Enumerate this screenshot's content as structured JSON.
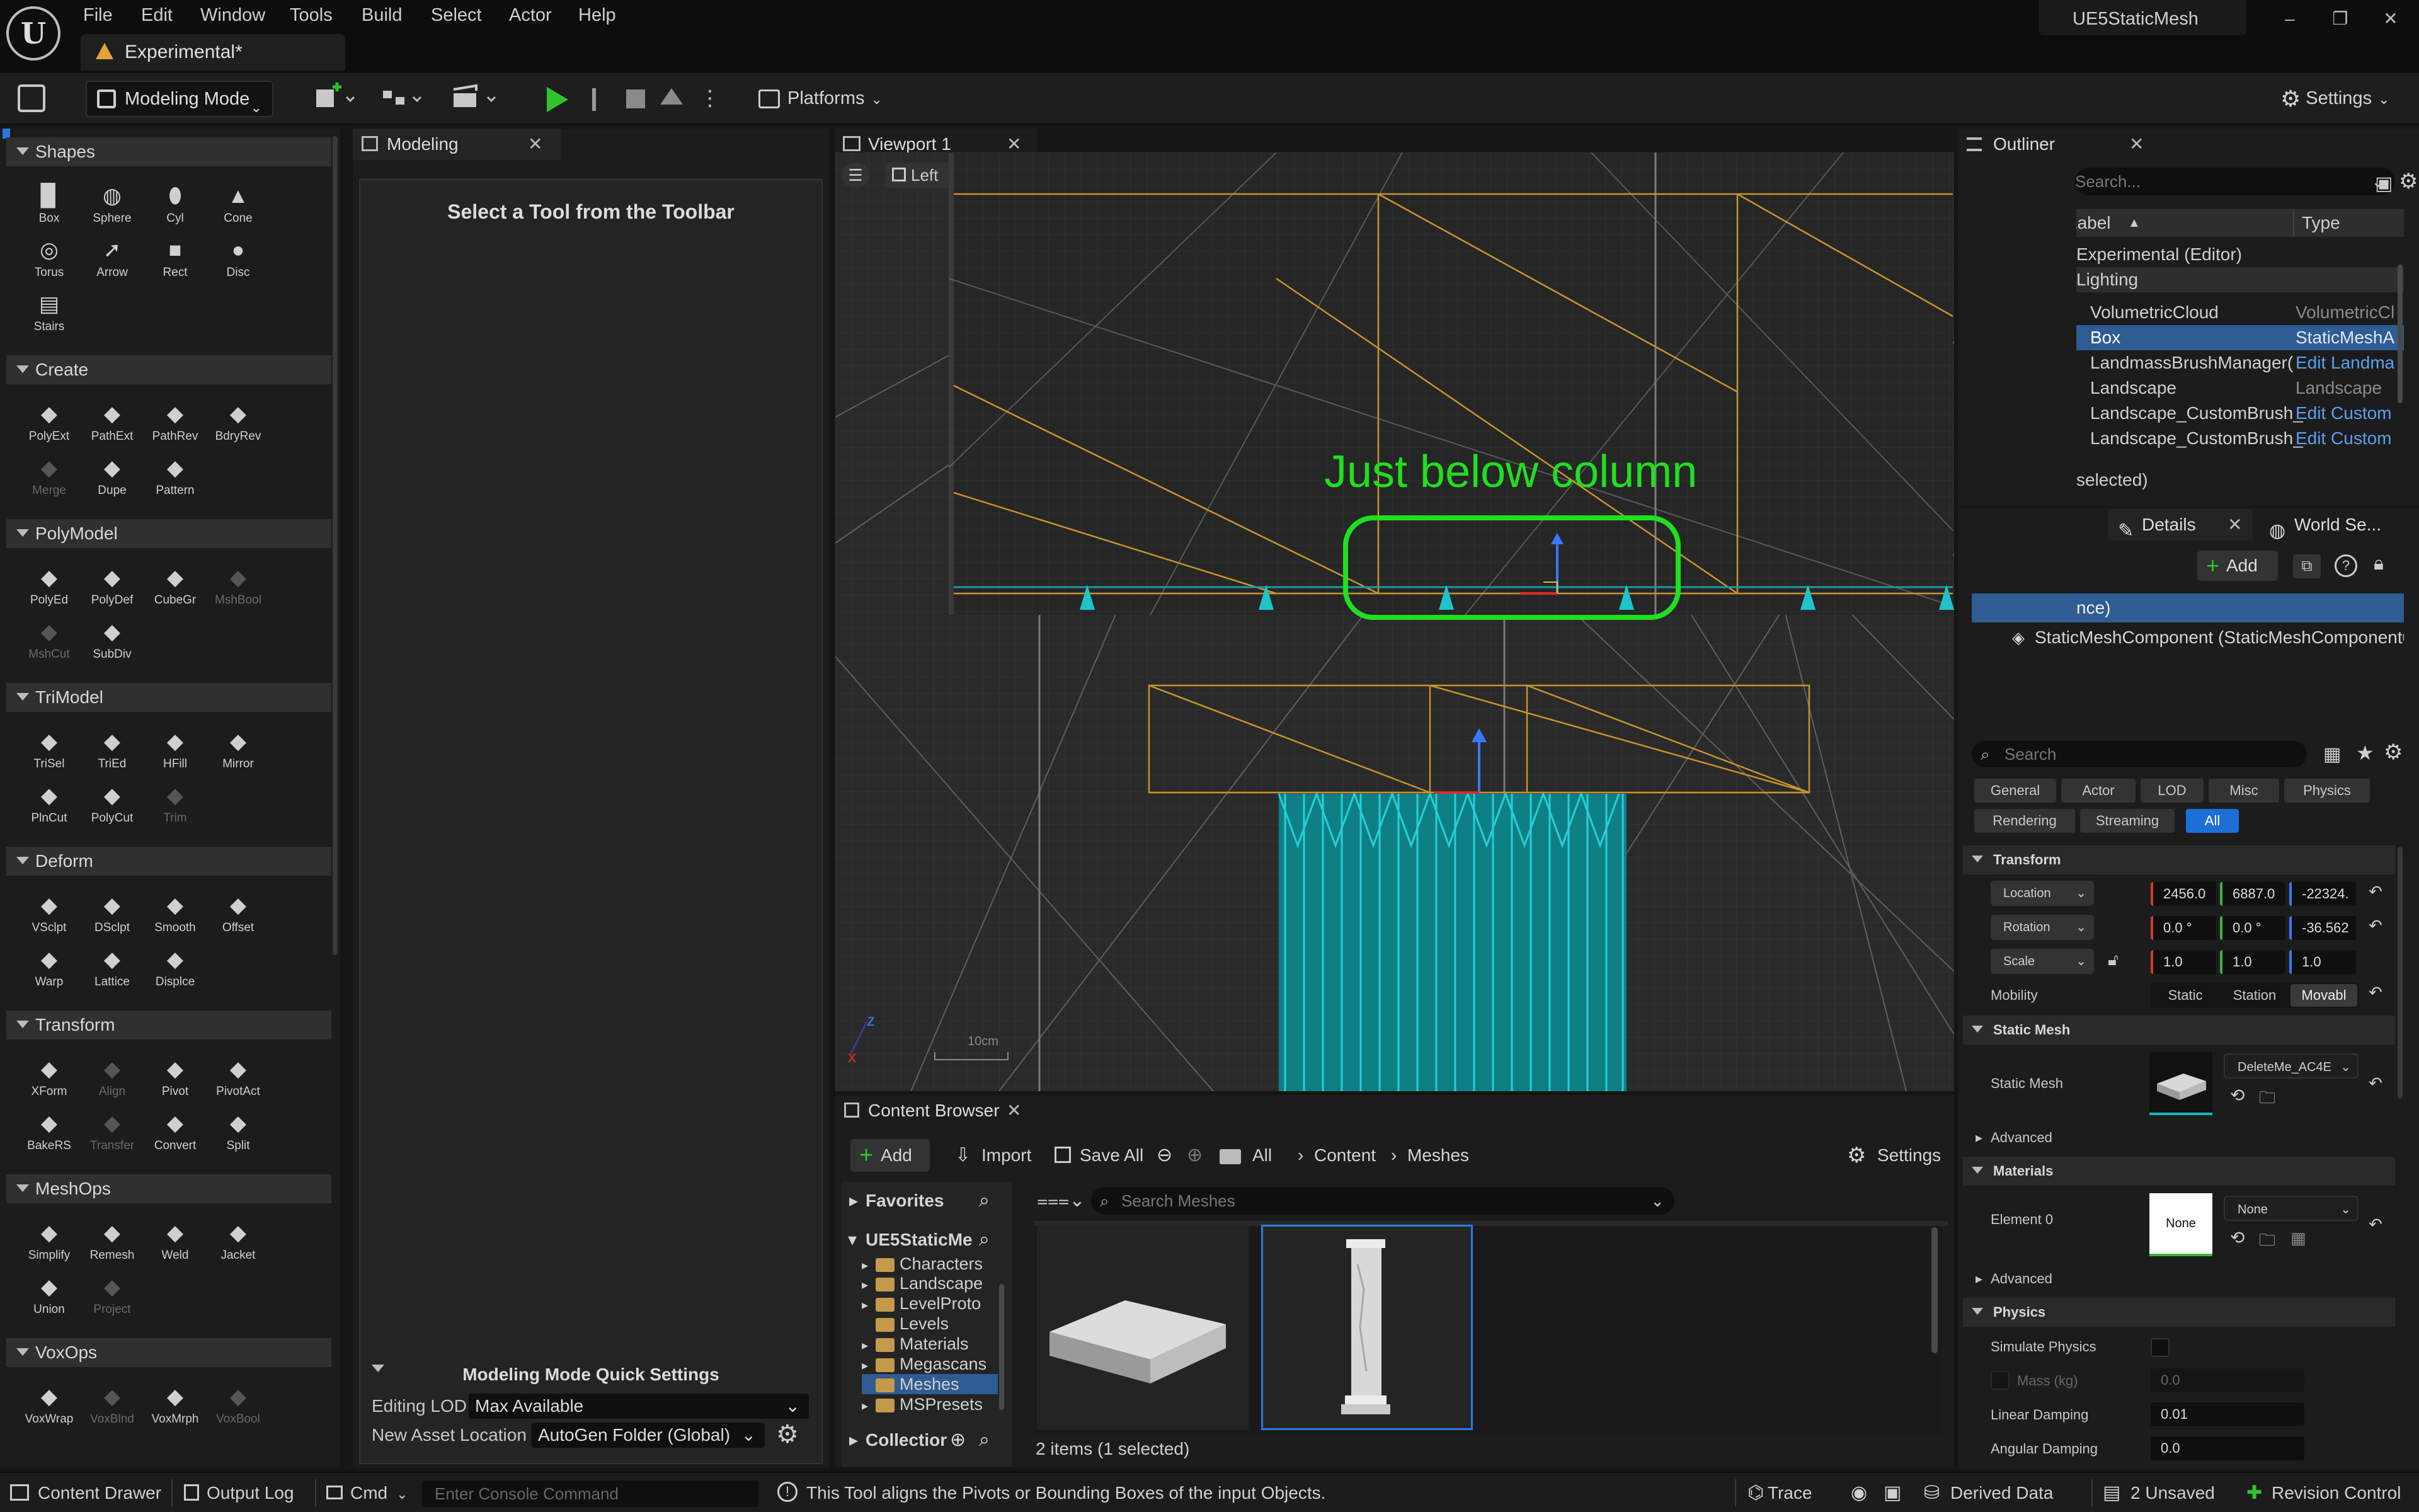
{
  "app": {
    "project": "UE5StaticMesh",
    "document_tab": "Experimental*",
    "menu": [
      "File",
      "Edit",
      "Window",
      "Tools",
      "Build",
      "Select",
      "Actor",
      "Help"
    ]
  },
  "toolbar": {
    "mode": "Modeling Mode",
    "platforms": "Platforms",
    "settings": "Settings"
  },
  "modeling_panel": {
    "tab": "Modeling",
    "prompt": "Select a Tool from the Toolbar",
    "quick_settings_title": "Modeling Mode Quick Settings",
    "editing_lod_label": "Editing LOD",
    "editing_lod_value": "Max Available",
    "asset_location_label": "New Asset Location",
    "asset_location_value": "AutoGen Folder (Global)"
  },
  "palette": {
    "sections": [
      {
        "title": "Shapes",
        "tools": [
          {
            "label": "Box",
            "icon": "box-icon"
          },
          {
            "label": "Sphere",
            "icon": "sphere-icon"
          },
          {
            "label": "Cyl",
            "icon": "cylinder-icon"
          },
          {
            "label": "Cone",
            "icon": "cone-icon"
          },
          {
            "label": "Torus",
            "icon": "torus-icon"
          },
          {
            "label": "Arrow",
            "icon": "arrow-icon"
          },
          {
            "label": "Rect",
            "icon": "rect-icon"
          },
          {
            "label": "Disc",
            "icon": "disc-icon"
          },
          {
            "label": "Stairs",
            "icon": "stairs-icon"
          }
        ]
      },
      {
        "title": "Create",
        "tools": [
          {
            "label": "PolyExt",
            "icon": "polyext-icon"
          },
          {
            "label": "PathExt",
            "icon": "pathext-icon"
          },
          {
            "label": "PathRev",
            "icon": "pathrev-icon"
          },
          {
            "label": "BdryRev",
            "icon": "bdryrev-icon"
          },
          {
            "label": "Merge",
            "icon": "merge-icon",
            "disabled": true
          },
          {
            "label": "Dupe",
            "icon": "dupe-icon"
          },
          {
            "label": "Pattern",
            "icon": "pattern-icon"
          }
        ]
      },
      {
        "title": "PolyModel",
        "tools": [
          {
            "label": "PolyEd",
            "icon": "polyed-icon"
          },
          {
            "label": "PolyDef",
            "icon": "polydef-icon"
          },
          {
            "label": "CubeGr",
            "icon": "cubegr-icon"
          },
          {
            "label": "MshBool",
            "icon": "mshbool-icon",
            "disabled": true
          },
          {
            "label": "MshCut",
            "icon": "mshcut-icon",
            "disabled": true
          },
          {
            "label": "SubDiv",
            "icon": "subdiv-icon"
          }
        ]
      },
      {
        "title": "TriModel",
        "tools": [
          {
            "label": "TriSel",
            "icon": "trisel-icon"
          },
          {
            "label": "TriEd",
            "icon": "tried-icon"
          },
          {
            "label": "HFill",
            "icon": "hfill-icon"
          },
          {
            "label": "Mirror",
            "icon": "mirror-icon"
          },
          {
            "label": "PlnCut",
            "icon": "plncut-icon"
          },
          {
            "label": "PolyCut",
            "icon": "polycut-icon"
          },
          {
            "label": "Trim",
            "icon": "trim-icon",
            "disabled": true
          }
        ]
      },
      {
        "title": "Deform",
        "tools": [
          {
            "label": "VSclpt",
            "icon": "vsclpt-icon"
          },
          {
            "label": "DSclpt",
            "icon": "dsclpt-icon"
          },
          {
            "label": "Smooth",
            "icon": "smooth-icon"
          },
          {
            "label": "Offset",
            "icon": "offset-icon"
          },
          {
            "label": "Warp",
            "icon": "warp-icon"
          },
          {
            "label": "Lattice",
            "icon": "lattice-icon"
          },
          {
            "label": "Displce",
            "icon": "displace-icon"
          }
        ]
      },
      {
        "title": "Transform",
        "tools": [
          {
            "label": "XForm",
            "icon": "xform-icon"
          },
          {
            "label": "Align",
            "icon": "align-icon",
            "disabled": true
          },
          {
            "label": "Pivot",
            "icon": "pivot-icon"
          },
          {
            "label": "PivotAct",
            "icon": "pivotact-icon"
          },
          {
            "label": "BakeRS",
            "icon": "bakers-icon"
          },
          {
            "label": "Transfer",
            "icon": "transfer-icon",
            "disabled": true
          },
          {
            "label": "Convert",
            "icon": "convert-icon"
          },
          {
            "label": "Split",
            "icon": "split-icon"
          }
        ]
      },
      {
        "title": "MeshOps",
        "tools": [
          {
            "label": "Simplify",
            "icon": "simplify-icon"
          },
          {
            "label": "Remesh",
            "icon": "remesh-icon"
          },
          {
            "label": "Weld",
            "icon": "weld-icon"
          },
          {
            "label": "Jacket",
            "icon": "jacket-icon"
          },
          {
            "label": "Union",
            "icon": "union-icon"
          },
          {
            "label": "Project",
            "icon": "project-icon",
            "disabled": true
          }
        ]
      },
      {
        "title": "VoxOps",
        "tools": [
          {
            "label": "VoxWrap",
            "icon": "voxwrap-icon"
          },
          {
            "label": "VoxBlnd",
            "icon": "voxblnd-icon",
            "disabled": true
          },
          {
            "label": "VoxMrph",
            "icon": "voxmrph-icon"
          },
          {
            "label": "VoxBool",
            "icon": "voxbool-icon",
            "disabled": true
          }
        ]
      }
    ]
  },
  "viewport": {
    "tab": "Viewport 1",
    "view_label": "Left",
    "annotation": "Just below column",
    "scale_label": "10cm",
    "annotation_color": "#1fe01f"
  },
  "outliner": {
    "tab": "Outliner",
    "search_placeholder": "Search...",
    "col_label": "Label",
    "col_type": "Type",
    "rows": [
      {
        "label": "Experimental (Editor)",
        "type": ""
      },
      {
        "label": "Lighting",
        "type": ""
      },
      {
        "label": "VolumetricCloud",
        "type": "VolumetricCl"
      },
      {
        "label": "Box",
        "type": "StaticMeshA",
        "selected": true
      },
      {
        "label": "LandmassBrushManager(",
        "type": "Edit Landma",
        "link": true
      },
      {
        "label": "Landscape",
        "type": "Landscape"
      },
      {
        "label": "Landscape_CustomBrush_",
        "type": "Edit Custom",
        "link": true
      },
      {
        "label": "Landscape_CustomBrush_",
        "type": "Edit Custom",
        "link": true
      }
    ],
    "footer": "selected)"
  },
  "details": {
    "tab": "Details",
    "tab2": "World Se...",
    "add": "Add",
    "instance_row": "nce)",
    "component": "StaticMeshComponent (StaticMeshComponent0",
    "search_placeholder": "Search",
    "categories_row1": [
      "General",
      "Actor",
      "LOD",
      "Misc",
      "Physics"
    ],
    "categories_row2": [
      "Rendering",
      "Streaming",
      "All"
    ],
    "transform_header": "Transform",
    "location_label": "Location",
    "location": [
      "2456.0",
      "6887.0",
      "-22324."
    ],
    "rotation_label": "Rotation",
    "rotation": [
      "0.0 °",
      "0.0 °",
      "-36.562"
    ],
    "scale_label": "Scale",
    "scale": [
      "1.0",
      "1.0",
      "1.0"
    ],
    "mobility_label": "Mobility",
    "mobility": [
      "Static",
      "Station",
      "Movabl"
    ],
    "static_mesh_header": "Static Mesh",
    "static_mesh_label": "Static Mesh",
    "static_mesh_value": "DeleteMe_AC4E",
    "advanced": "Advanced",
    "materials_header": "Materials",
    "element0_label": "Element 0",
    "element0_thumb": "None",
    "element0_value": "None",
    "physics_header": "Physics",
    "simulate_physics": "Simulate Physics",
    "mass_label": "Mass (kg)",
    "mass_value": "0.0",
    "linear_damping_label": "Linear Damping",
    "linear_damping": "0.01",
    "angular_damping_label": "Angular Damping",
    "angular_damping": "0.0"
  },
  "content_browser": {
    "tab": "Content Browser",
    "add": "Add",
    "import": "Import",
    "save_all": "Save All",
    "path": [
      "All",
      "Content",
      "Meshes"
    ],
    "settings": "Settings",
    "favorites": "Favorites",
    "root": "UE5StaticMe",
    "folders": [
      "Characters",
      "Landscape",
      "LevelProto",
      "Levels",
      "Materials",
      "Megascans",
      "Meshes",
      "MSPresets"
    ],
    "collections": "Collectior",
    "search_placeholder": "Search Meshes",
    "items_count": "2 items (1 selected)"
  },
  "statusbar": {
    "content_drawer": "Content Drawer",
    "output_log": "Output Log",
    "cmd": "Cmd",
    "console_placeholder": "Enter Console Command",
    "hint": "This Tool aligns the Pivots or Bounding Boxes of the input Objects.",
    "trace": "Trace",
    "derived_data": "Derived Data",
    "unsaved": "2 Unsaved",
    "revision": "Revision Control"
  }
}
